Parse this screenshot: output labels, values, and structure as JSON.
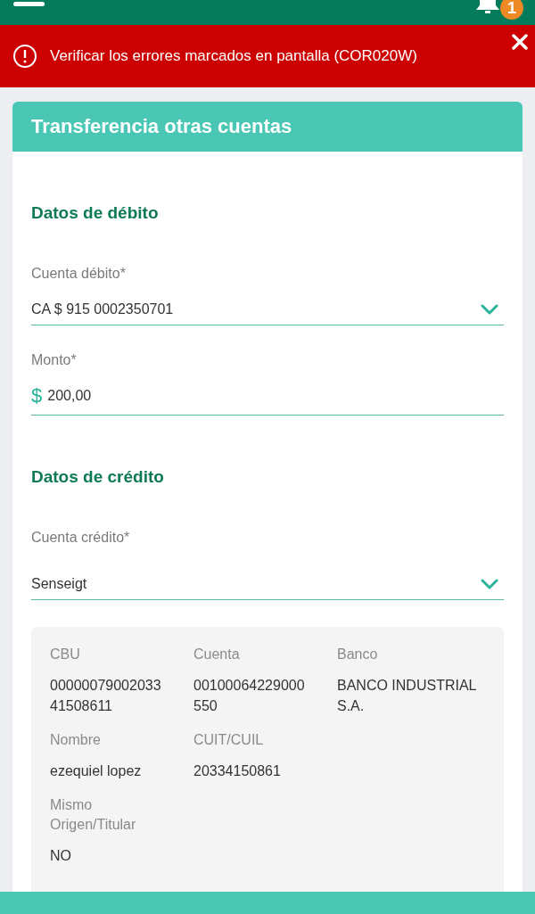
{
  "app_bar": {
    "notification_count": "1"
  },
  "error_banner": {
    "message": "Verificar los errores marcados en pantalla (COR020W)"
  },
  "card": {
    "title": "Transferencia otras cuentas",
    "sections": [
      {
        "title": "Datos de débito",
        "fields": [
          {
            "kind": "select",
            "label": "Cuenta débito*",
            "value": "CA $ 915 0002350701"
          },
          {
            "kind": "amount",
            "label": "Monto*",
            "currency": "$",
            "value": "200,00"
          }
        ]
      },
      {
        "title": "Datos de crédito",
        "fields": [
          {
            "kind": "select",
            "label": "Cuenta crédito*",
            "value": "Senseigt"
          }
        ]
      }
    ],
    "details": [
      [
        {
          "label": "CBU",
          "value": "0000007900203341508611"
        },
        {
          "label": "Cuenta",
          "value": "00100064229000550"
        },
        {
          "label": "Banco",
          "value": "BANCO INDUSTRIAL S.A."
        }
      ],
      [
        {
          "label": "Nombre",
          "value": "ezequiel lopez"
        },
        {
          "label": "CUIT/CUIL",
          "value": "20334150861"
        }
      ],
      [
        {
          "label": "Mismo Origen/Titular",
          "value": "NO"
        }
      ]
    ]
  }
}
